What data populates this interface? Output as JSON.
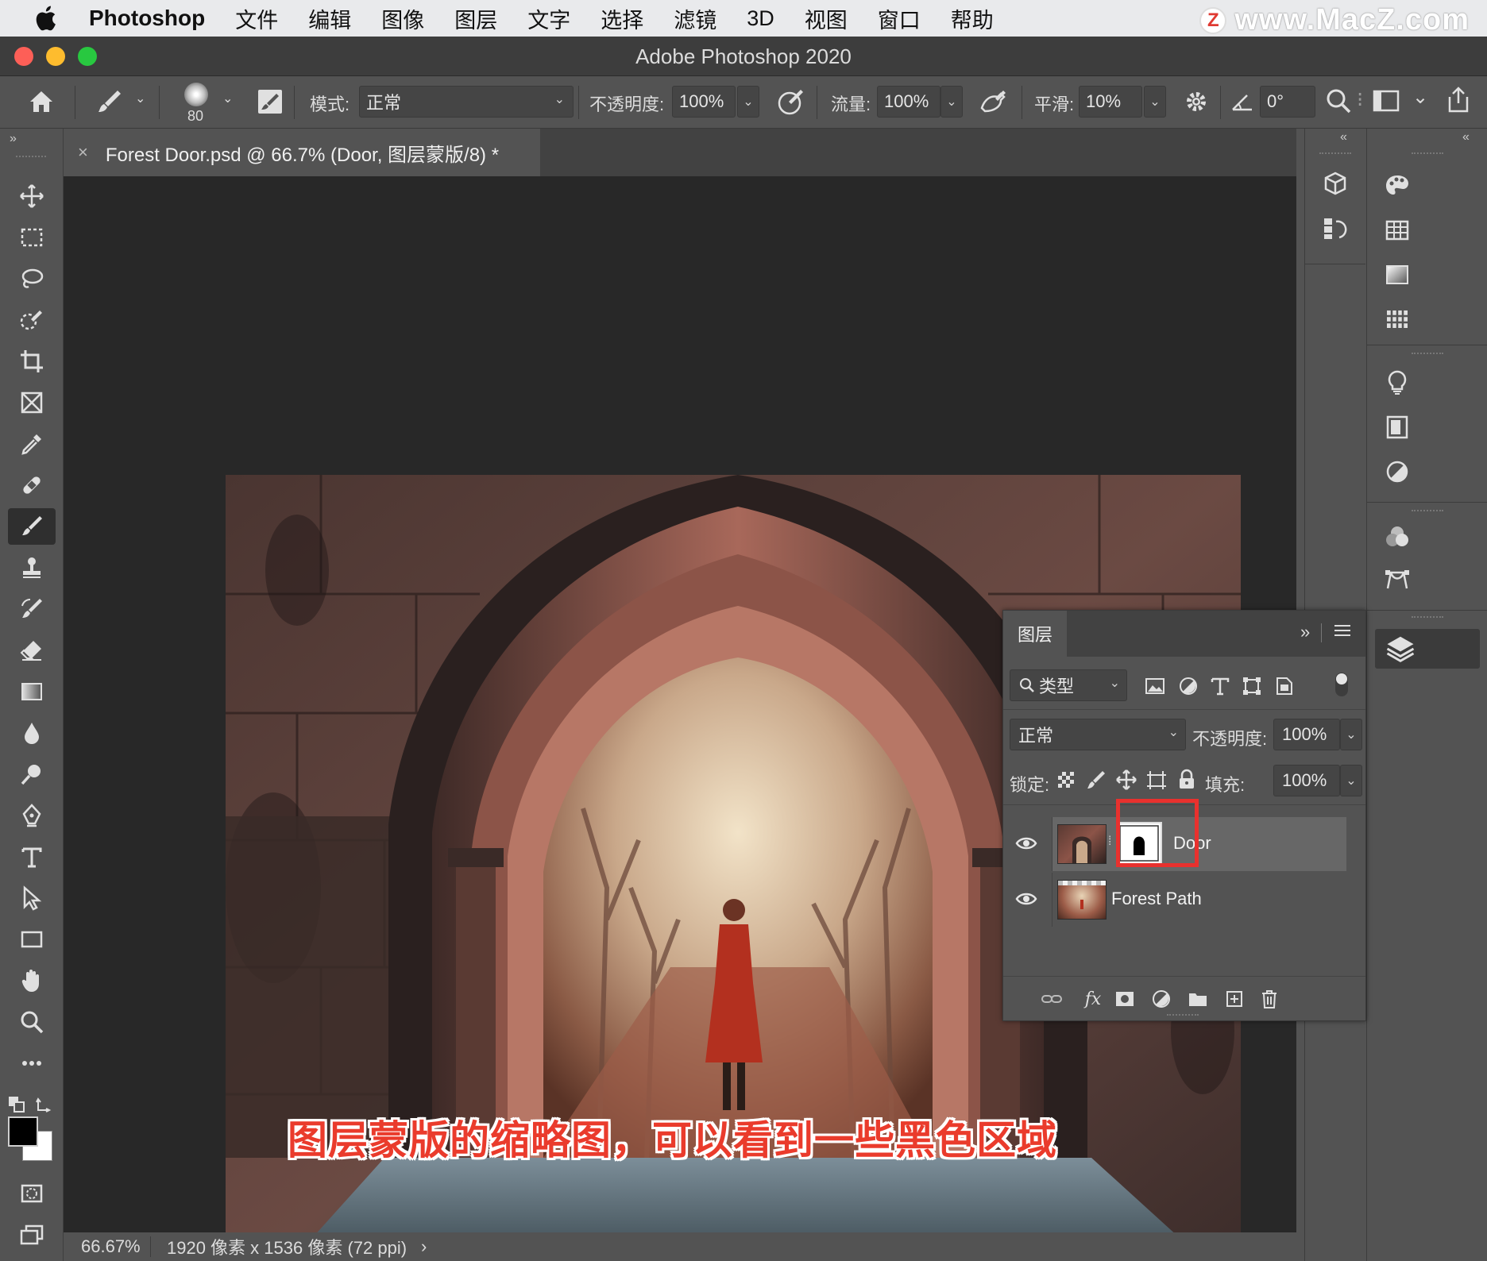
{
  "menubar": {
    "app_name": "Photoshop",
    "items": [
      "文件",
      "编辑",
      "图像",
      "图层",
      "文字",
      "选择",
      "滤镜",
      "3D",
      "视图",
      "窗口",
      "帮助"
    ],
    "watermark_badge": "Z",
    "watermark_text": "www.MacZ.com"
  },
  "window": {
    "title": "Adobe Photoshop 2020"
  },
  "options": {
    "brush_size": "80",
    "mode_label": "模式:",
    "mode_value": "正常",
    "opacity_label": "不透明度:",
    "opacity_value": "100%",
    "flow_label": "流量:",
    "flow_value": "100%",
    "smoothing_label": "平滑:",
    "smoothing_value": "10%",
    "angle_value": "0°"
  },
  "document": {
    "tab_title": "Forest Door.psd @ 66.7% (Door, 图层蒙版/8) *",
    "close": "×"
  },
  "status": {
    "zoom": "66.67%",
    "dimensions": "1920 像素 x 1536 像素 (72 ppi)",
    "arrow": "›"
  },
  "layers_panel": {
    "tab_label": "图层",
    "filter_kind": "类型",
    "blend_mode": "正常",
    "opacity_label": "不透明度:",
    "opacity_value": "100%",
    "lock_label": "锁定:",
    "fill_label": "填充:",
    "fill_value": "100%",
    "layers": [
      {
        "name": "Door",
        "selected": true,
        "has_mask": true
      },
      {
        "name": "Forest Path",
        "selected": false,
        "has_mask": false
      }
    ]
  },
  "annotation": {
    "caption": "图层蒙版的缩略图，可以看到一些黑色区域",
    "highlight_color": "#e8312e"
  },
  "colors": {
    "traffic_red": "#fd5f57",
    "traffic_yellow": "#febc2e",
    "traffic_green": "#28c840",
    "caption_red": "#ea3b2c"
  }
}
